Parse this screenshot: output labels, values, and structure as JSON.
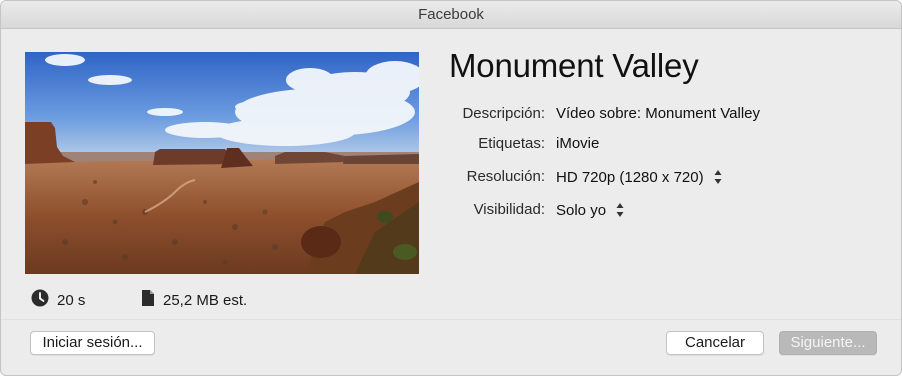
{
  "window": {
    "title": "Facebook"
  },
  "video": {
    "title": "Monument Valley",
    "duration": "20 s",
    "size": "25,2 MB est."
  },
  "fields": {
    "description": {
      "label": "Descripción:",
      "value": "Vídeo sobre: Monument Valley"
    },
    "tags": {
      "label": "Etiquetas:",
      "value": "iMovie"
    },
    "resolution": {
      "label": "Resolución:",
      "value": "HD 720p (1280 x 720)"
    },
    "visibility": {
      "label": "Visibilidad:",
      "value": "Solo yo"
    }
  },
  "buttons": {
    "signin": "Iniciar sesión...",
    "cancel": "Cancelar",
    "next": "Siguiente..."
  },
  "icons": {
    "duration": "clock-icon",
    "size": "document-icon",
    "stepper": "up-down-arrows-icon"
  },
  "colors": {
    "window_bg": "#ececec",
    "disabled_button": "#b9b9b9"
  }
}
